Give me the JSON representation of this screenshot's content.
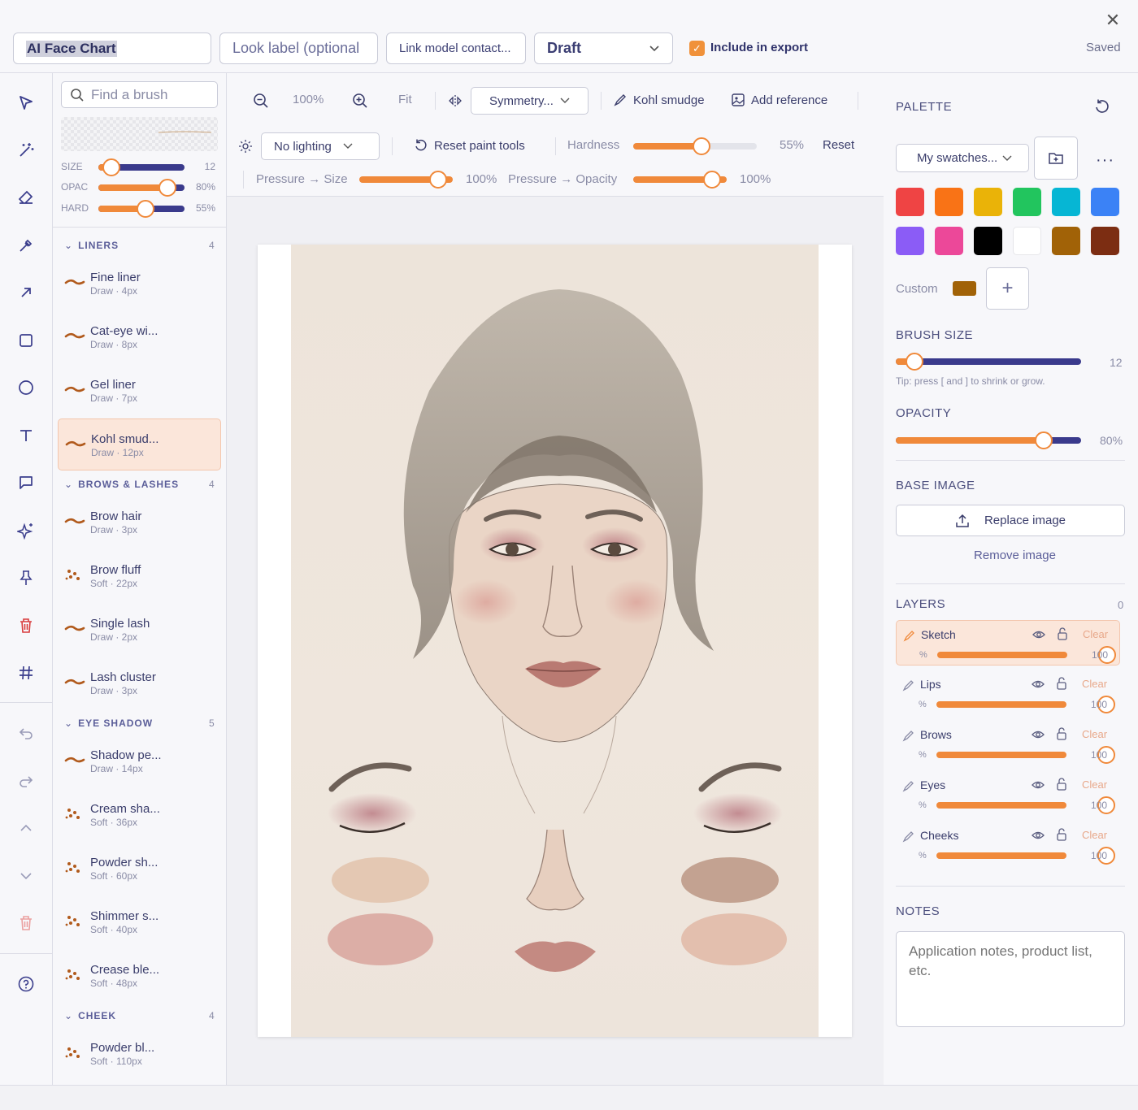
{
  "topbar": {
    "chart_title": "AI Face Chart",
    "look_label_placeholder": "Look label (optional",
    "link_model": "Link model contact...",
    "status_select": "Draft",
    "include_export": "Include in export",
    "saved": "Saved"
  },
  "brush_panel": {
    "search_placeholder": "Find a brush",
    "mini_sliders": [
      {
        "label": "SIZE",
        "value": "12",
        "fraction": 0.15
      },
      {
        "label": "OPAC",
        "value": "80%",
        "fraction": 0.8
      },
      {
        "label": "HARD",
        "value": "55%",
        "fraction": 0.55
      }
    ],
    "sections": [
      {
        "title": "LINERS",
        "count": "4",
        "items": [
          {
            "name": "Fine liner",
            "sub": "Draw · 4px",
            "kind": "line"
          },
          {
            "name": "Cat-eye wi...",
            "sub": "Draw · 8px",
            "kind": "line"
          },
          {
            "name": "Gel liner",
            "sub": "Draw · 7px",
            "kind": "line"
          },
          {
            "name": "Kohl smud...",
            "sub": "Draw · 12px",
            "kind": "line",
            "active": true
          }
        ]
      },
      {
        "title": "BROWS & LASHES",
        "count": "4",
        "items": [
          {
            "name": "Brow hair",
            "sub": "Draw · 3px",
            "kind": "line"
          },
          {
            "name": "Brow fluff",
            "sub": "Soft · 22px",
            "kind": "dots"
          },
          {
            "name": "Single lash",
            "sub": "Draw · 2px",
            "kind": "line"
          },
          {
            "name": "Lash cluster",
            "sub": "Draw · 3px",
            "kind": "line"
          }
        ]
      },
      {
        "title": "EYE SHADOW",
        "count": "5",
        "items": [
          {
            "name": "Shadow pe...",
            "sub": "Draw · 14px",
            "kind": "line"
          },
          {
            "name": "Cream sha...",
            "sub": "Soft · 36px",
            "kind": "dots"
          },
          {
            "name": "Powder sh...",
            "sub": "Soft · 60px",
            "kind": "dots"
          },
          {
            "name": "Shimmer s...",
            "sub": "Soft · 40px",
            "kind": "dots"
          },
          {
            "name": "Crease ble...",
            "sub": "Soft · 48px",
            "kind": "dots"
          }
        ]
      },
      {
        "title": "CHEEK",
        "count": "4",
        "items": [
          {
            "name": "Powder bl...",
            "sub": "Soft · 110px",
            "kind": "dots"
          }
        ]
      }
    ]
  },
  "toolbar": {
    "zoom": "100%",
    "fit": "Fit",
    "symmetry": "Symmetry...",
    "active_brush": "Kohl smudge",
    "add_reference": "Add reference",
    "lighting": "No lighting",
    "reset_paint": "Reset paint tools",
    "hardness_label": "Hardness",
    "hardness_value": "55%",
    "hardness_fraction": 0.55,
    "reset": "Reset",
    "pressure_size_label": "Pressure → Size",
    "pressure_size_value": "100%",
    "pressure_opacity_label": "Pressure → Opacity",
    "pressure_opacity_value": "100%"
  },
  "right_panel": {
    "palette_title": "PALETTE",
    "swatch_set": "My swatches...",
    "swatches": [
      "#ef4444",
      "#f97316",
      "#eab308",
      "#22c55e",
      "#06b6d4",
      "#3b82f6",
      "#8b5cf6",
      "#ec4899",
      "#000000",
      "#ffffff",
      "#a16207",
      "#7c2d12"
    ],
    "custom_label": "Custom",
    "custom_color": "#a16207",
    "brush_size_title": "BRUSH SIZE",
    "brush_size_value": "12",
    "brush_size_fraction": 0.1,
    "brush_tip": "Tip: press [ and ] to shrink or grow.",
    "opacity_title": "OPACITY",
    "opacity_value": "80%",
    "opacity_fraction": 0.8,
    "base_image_title": "BASE IMAGE",
    "replace_image": "Replace image",
    "remove_image": "Remove image",
    "layers_title": "LAYERS",
    "layers_count": "0",
    "layers": [
      {
        "name": "Sketch",
        "value": "100",
        "active": true
      },
      {
        "name": "Lips",
        "value": "100"
      },
      {
        "name": "Brows",
        "value": "100"
      },
      {
        "name": "Eyes",
        "value": "100"
      },
      {
        "name": "Cheeks",
        "value": "100"
      }
    ],
    "layer_clear": "Clear",
    "layer_pct": "%",
    "notes_title": "NOTES",
    "notes_placeholder": "Application notes, product list, etc."
  },
  "colors": {
    "accent": "#f0893a",
    "navy": "#3a3a8c"
  }
}
